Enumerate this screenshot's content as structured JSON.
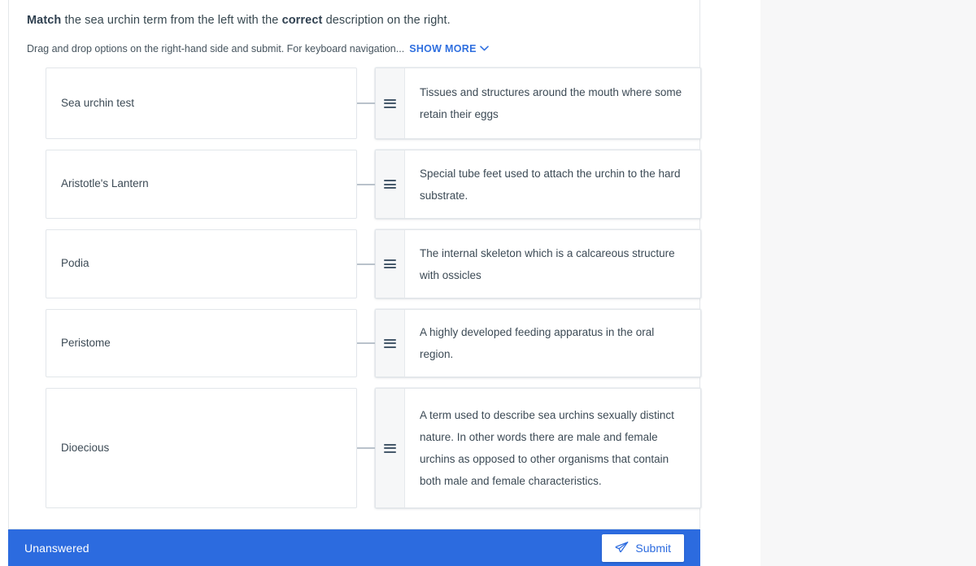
{
  "question": {
    "prompt_bold_1": "Match",
    "prompt_mid_1": " the sea urchin term from the left with the ",
    "prompt_bold_2": "correct",
    "prompt_mid_2": " description on the right.",
    "instructions": "Drag and drop options on the right-hand side and submit. For keyboard navigation...",
    "show_more_label": "SHOW MORE",
    "chevron_glyph": "⌄"
  },
  "rows": [
    {
      "term": "Sea urchin test",
      "description": "Tissues and structures around the mouth where some retain their eggs",
      "handle_icon": "drag-handle-icon"
    },
    {
      "term": "Aristotle's Lantern",
      "description": "Special tube feet used to attach the urchin to the hard substrate.",
      "handle_icon": "drag-handle-icon"
    },
    {
      "term": "Podia",
      "description": "The internal skeleton which is a calcareous structure with ossicles",
      "handle_icon": "drag-handle-icon"
    },
    {
      "term": "Peristome",
      "description": "A highly developed feeding apparatus in the oral region.",
      "handle_icon": "drag-handle-icon"
    },
    {
      "term": "Dioecious",
      "description": "A term used to describe sea urchins sexually distinct nature. In other words there are male and female urchins as opposed to other organisms that contain both male and female characteristics.",
      "handle_icon": "drag-handle-icon"
    }
  ],
  "footer": {
    "status": "Unanswered",
    "submit_label": "Submit",
    "submit_icon": "send-paper-plane-icon",
    "bar_color": "#2c6bdf",
    "submit_text_color": "#2c6bdf"
  },
  "colors": {
    "accent": "#2c6bdf",
    "link": "#2f6fdf",
    "text": "#3c4a55",
    "card_border": "#e2e6ea",
    "handle_bg": "#f6f7f8",
    "page_bg": "#f7f7f8"
  }
}
